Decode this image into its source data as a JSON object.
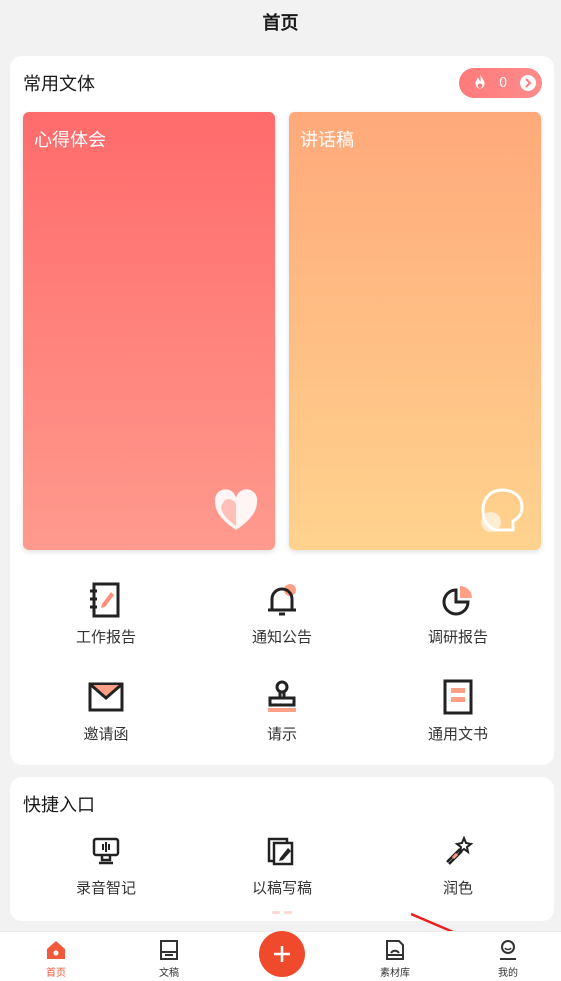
{
  "header": {
    "title": "首页"
  },
  "common": {
    "title": "常用文体",
    "badge_count": "0",
    "cards": [
      {
        "label": "心得体会",
        "icon": "heart-icon"
      },
      {
        "label": "讲话稿",
        "icon": "speech-bubble-icon"
      }
    ],
    "grid": [
      {
        "label": "工作报告",
        "icon": "notebook-icon"
      },
      {
        "label": "通知公告",
        "icon": "bell-icon"
      },
      {
        "label": "调研报告",
        "icon": "pie-chart-icon"
      },
      {
        "label": "邀请函",
        "icon": "envelope-icon"
      },
      {
        "label": "请示",
        "icon": "stamp-icon"
      },
      {
        "label": "通用文书",
        "icon": "document-icon"
      }
    ]
  },
  "quick": {
    "title": "快捷入口",
    "items": [
      {
        "label": "录音智记",
        "icon": "recorder-icon"
      },
      {
        "label": "以稿写稿",
        "icon": "copy-edit-icon"
      },
      {
        "label": "润色",
        "icon": "magic-wand-icon"
      }
    ]
  },
  "tabbar": {
    "items": [
      {
        "label": "首页",
        "icon": "home-icon",
        "active": true
      },
      {
        "label": "文稿",
        "icon": "manuscript-icon"
      },
      {
        "label": "素材库",
        "icon": "library-icon"
      },
      {
        "label": "我的",
        "icon": "user-icon"
      }
    ],
    "accent": "#f04a2c"
  }
}
